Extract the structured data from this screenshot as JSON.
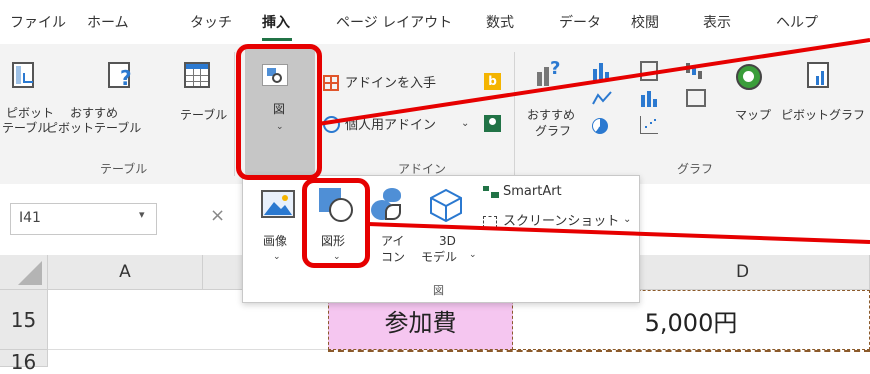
{
  "tabs": [
    "ファイル",
    "ホーム",
    "タッチ",
    "挿入",
    "ページ レイアウト",
    "数式",
    "データ",
    "校閲",
    "表示",
    "ヘルプ"
  ],
  "ribbon": {
    "pivot_label_1": "ピボット",
    "pivot_label_2": "テーブル",
    "rec_pivot_1": "おすすめ",
    "rec_pivot_2": "ピボットテーブル",
    "table_label": "テーブル",
    "group_table": "テーブル",
    "illust_label": "図",
    "addin_get": "アドインを入手",
    "addin_personal": "個人用アドイン",
    "group_addin": "アドイン",
    "rec_chart_1": "おすすめ",
    "rec_chart_2": "グラフ",
    "map_label": "マップ",
    "pivot_chart_label": "ピボットグラフ",
    "group_chart": "グラフ"
  },
  "dropdown": {
    "image_1": "画像",
    "shape_1": "図形",
    "icon_1": "アイ",
    "icon_2": "コン",
    "model_1": "3D",
    "model_2": "モデル",
    "smartart": "SmartArt",
    "screenshot": "スクリーンショット",
    "group_label": "図"
  },
  "namebox": {
    "value": "I41"
  },
  "columns": {
    "a": "A",
    "d": "D"
  },
  "rows": {
    "r15": "15",
    "r16": "16"
  },
  "cells": {
    "c15": "参加費",
    "d15": "5,000円"
  },
  "colors": {
    "highlight": "#e60000",
    "accent": "#217346",
    "cell_pink": "#f5c6f0"
  }
}
